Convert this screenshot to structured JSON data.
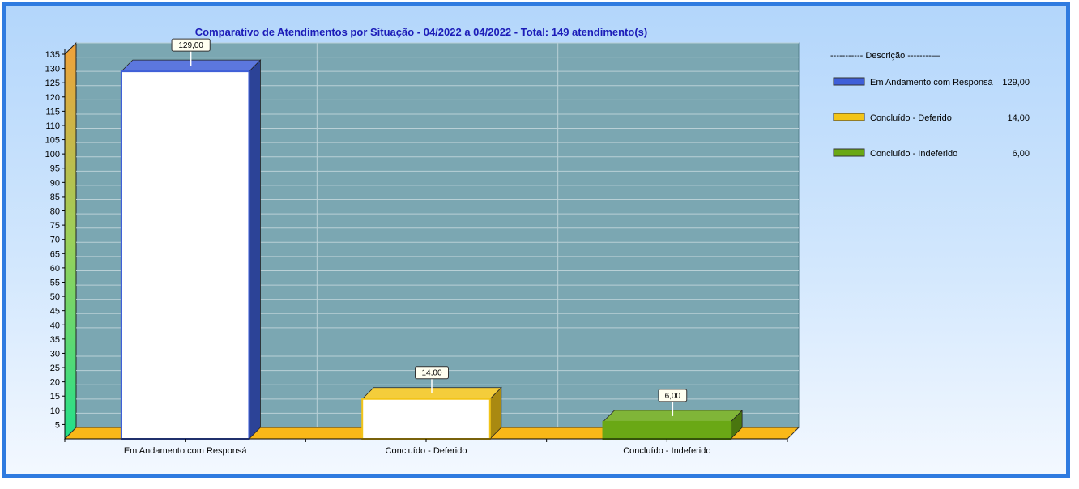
{
  "chart_data": {
    "type": "bar",
    "title": "Comparativo de Atendimentos por Situação - 04/2022 a 04/2022 - Total: 149 atendimento(s)",
    "xlabel": "",
    "ylabel": "",
    "ylim": [
      0,
      135
    ],
    "yticks": [
      5,
      10,
      15,
      20,
      25,
      30,
      35,
      40,
      45,
      50,
      55,
      60,
      65,
      70,
      75,
      80,
      85,
      90,
      95,
      100,
      105,
      110,
      115,
      120,
      125,
      130,
      135
    ],
    "categories": [
      "Em Andamento com Responsá",
      "Concluído - Deferido",
      "Concluído - Indeferido"
    ],
    "values": [
      129,
      14,
      6
    ],
    "data_labels": [
      "129,00",
      "14,00",
      "6,00"
    ],
    "colors": [
      "#3f5fd8",
      "#f2c418",
      "#6aa815"
    ],
    "grid": true,
    "legend_position": "right",
    "legend": {
      "header": "----------- Descrição --------—",
      "items": [
        {
          "label": "Em Andamento com Responsá",
          "value": "129,00"
        },
        {
          "label": "Concluído - Deferido",
          "value": "14,00"
        },
        {
          "label": "Concluído - Indeferido",
          "value": "6,00"
        }
      ]
    }
  }
}
